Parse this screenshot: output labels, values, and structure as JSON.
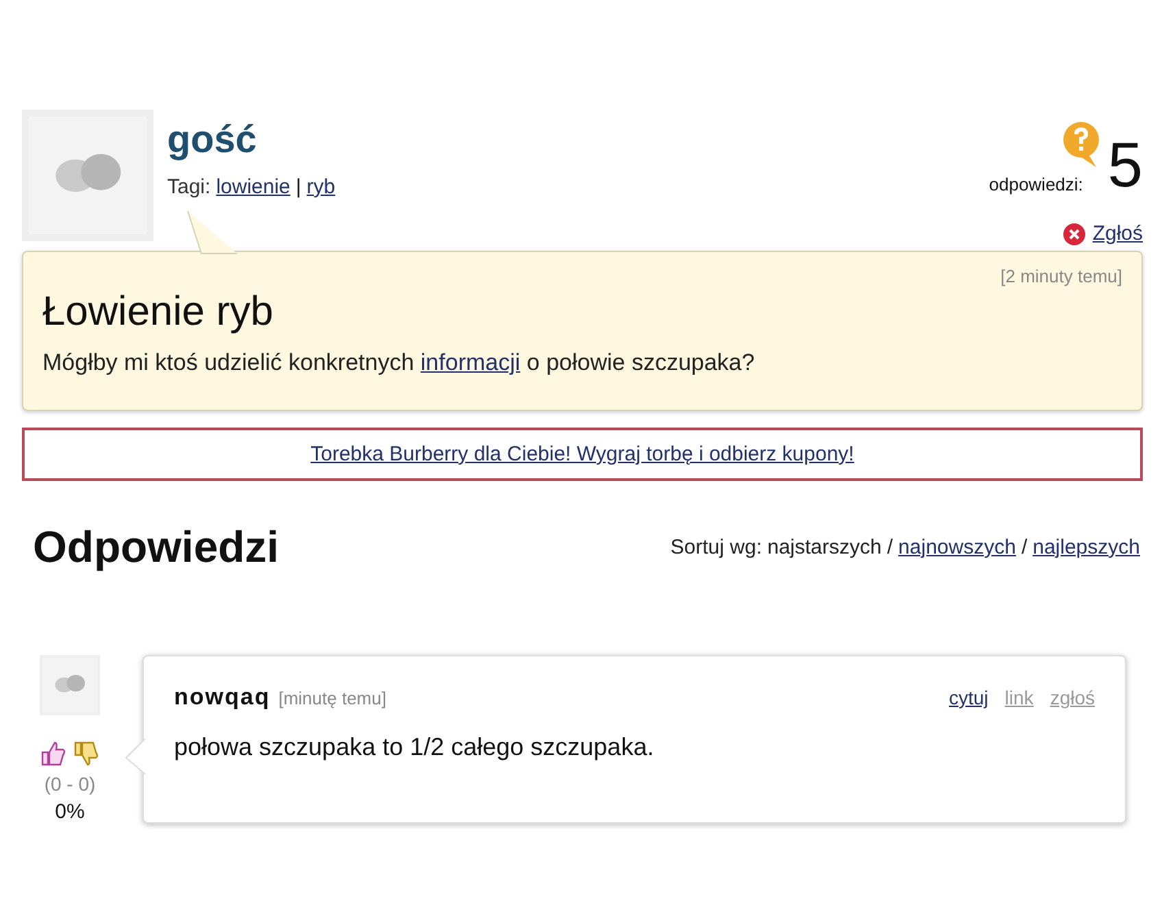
{
  "question": {
    "author": "gość",
    "tags_label": "Tagi:",
    "tags": [
      "lowienie",
      "ryb"
    ],
    "tag_separator": "|",
    "answers_label": "odpowiedzi:",
    "answers_count": "5",
    "report": "Zgłoś",
    "time": "[2 minuty temu]",
    "title": "Łowienie ryb",
    "body_before": "Mógłby mi ktoś udzielić konkretnych",
    "body_link": "informacji",
    "body_after": "o połowie szczupaka?"
  },
  "ad": {
    "text": "Torebka Burberry dla Ciebie! Wygraj torbę i odbierz kupony!"
  },
  "answers_section": {
    "title": "Odpowiedzi",
    "sort_label": "Sortuj wg:",
    "sort_options": [
      {
        "label": "najstarszych",
        "selected": true
      },
      {
        "label": "najnowszych",
        "selected": false
      },
      {
        "label": "najlepszych",
        "selected": false
      }
    ],
    "separator": "/"
  },
  "answers": [
    {
      "author": "nowqaq",
      "time": "[minutę temu]",
      "text": "połowa szczupaka to 1/2 całego szczupaka.",
      "score": "(0 - 0)",
      "percent": "0%",
      "actions": [
        {
          "label": "cytuj",
          "muted": false
        },
        {
          "label": "link",
          "muted": true
        },
        {
          "label": "zgłoś",
          "muted": true
        }
      ]
    }
  ]
}
